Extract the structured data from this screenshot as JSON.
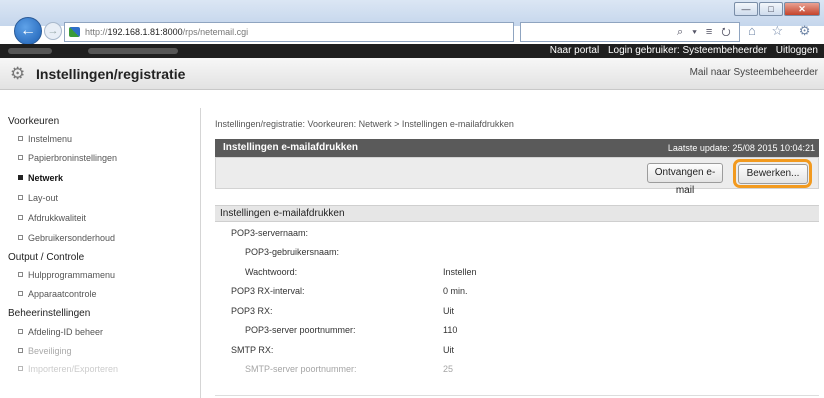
{
  "browser": {
    "url_prefix": "http://",
    "url_host": "192.168.1.81:8000",
    "url_path": "/rps/netemail.cgi",
    "search_text": "⌕ ▾ ≡ ⭮ ✕",
    "window_buttons": [
      "—",
      "□",
      "✕"
    ],
    "toolbar_icons": "⌂ ☆ ⚙"
  },
  "portal": {
    "links": [
      "Naar portal",
      "Login gebruiker: Systeembeheerder",
      "Uitloggen"
    ],
    "title": "Instellingen/registratie",
    "mail_link": "Mail naar Systeembeheerder"
  },
  "sidebar": {
    "groups": [
      {
        "label": "Voorkeuren",
        "items": [
          "Instelmenu",
          "Papierbroninstellingen",
          "Netwerk",
          "Lay-out",
          "Afdrukkwaliteit",
          "Gebruikersonderhoud"
        ]
      },
      {
        "label": "Output / Controle",
        "items": [
          "Hulpprogrammamenu",
          "Apparaatcontrole"
        ]
      },
      {
        "label": "Beheerinstellingen",
        "items": [
          "Afdeling-ID beheer",
          "Beveiliging",
          "Importeren/Exporteren"
        ]
      }
    ],
    "active_item": "Netwerk"
  },
  "main": {
    "breadcrumb": "Instellingen/registratie: Voorkeuren: Netwerk > Instellingen e-mailafdrukken",
    "panel_title": "Instellingen e-mailafdrukken",
    "last_update": "Laatste update: 25/08 2015 10:04:21",
    "receive_button": "Ontvangen e-mail",
    "edit_button": "Bewerken...",
    "section_title": "Instellingen e-mailafdrukken",
    "rows": [
      {
        "label": "POP3-servernaam:",
        "value": "",
        "indent": 0
      },
      {
        "label": "POP3-gebruikersnaam:",
        "value": "",
        "indent": 1
      },
      {
        "label": "Wachtwoord:",
        "value": "Instellen",
        "indent": 1
      },
      {
        "label": "POP3 RX-interval:",
        "value": "0 min.",
        "indent": 0
      },
      {
        "label": "POP3 RX:",
        "value": "Uit",
        "indent": 0
      },
      {
        "label": "POP3-server poortnummer:",
        "value": "110",
        "indent": 1
      },
      {
        "label": "SMTP RX:",
        "value": "Uit",
        "indent": 0
      },
      {
        "label": "SMTP-server poortnummer:",
        "value": "25",
        "indent": 1
      }
    ]
  },
  "colors": {
    "highlight": "#f29a1f",
    "panel_header": "#5a5a5a",
    "portal_bar": "#1f1f1f"
  }
}
